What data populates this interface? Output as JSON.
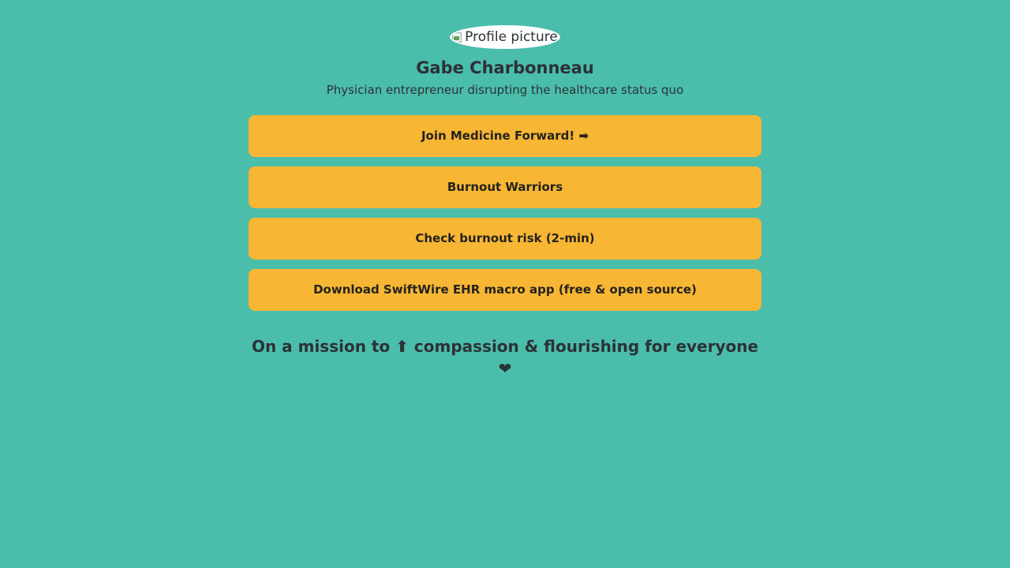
{
  "profile": {
    "avatar_alt": "Profile picture",
    "name": "Gabe Charbonneau",
    "bio": "Physician entrepreneur disrupting the healthcare status quo"
  },
  "links": [
    {
      "label": "Join Medicine Forward! ➡"
    },
    {
      "label": "Burnout Warriors"
    },
    {
      "label": "Check burnout risk (2-min)"
    },
    {
      "label": "Download SwiftWire EHR macro app (free & open source)"
    }
  ],
  "footer": {
    "mission": "On a mission to ⬆ compassion & flourishing for everyone ❤"
  },
  "colors": {
    "background": "#4bbdab",
    "button": "#f7b633",
    "text": "#2b3236"
  }
}
